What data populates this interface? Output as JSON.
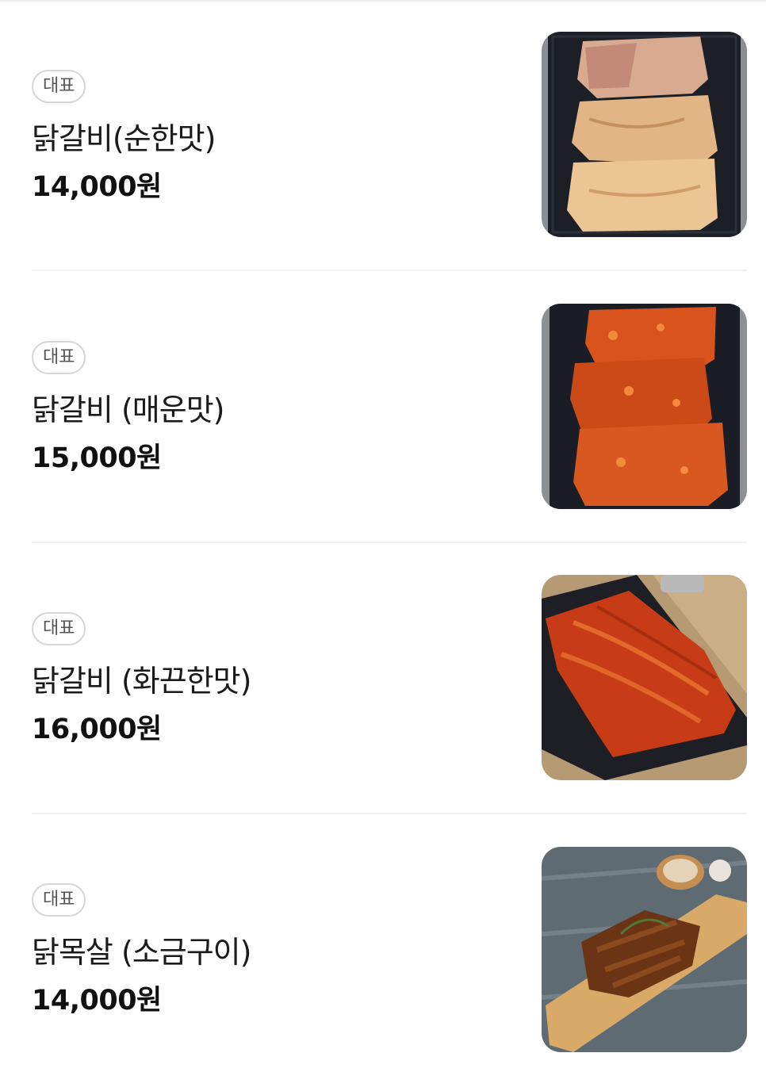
{
  "menu": {
    "items": [
      {
        "badge": "대표",
        "name": "닭갈비(순한맛)",
        "price": "14,000원",
        "image_icon": "mild-chicken-galbi-photo"
      },
      {
        "badge": "대표",
        "name": "닭갈비 (매운맛)",
        "price": "15,000원",
        "image_icon": "spicy-chicken-galbi-photo"
      },
      {
        "badge": "대표",
        "name": "닭갈비 (화끈한맛)",
        "price": "16,000원",
        "image_icon": "hot-chicken-galbi-photo"
      },
      {
        "badge": "대표",
        "name": "닭목살 (소금구이)",
        "price": "14,000원",
        "image_icon": "salt-grilled-chicken-neck-photo"
      }
    ]
  },
  "colors": {
    "badge_border": "#d6d6d6",
    "divider": "#f1f1f1",
    "text": "#111111"
  }
}
